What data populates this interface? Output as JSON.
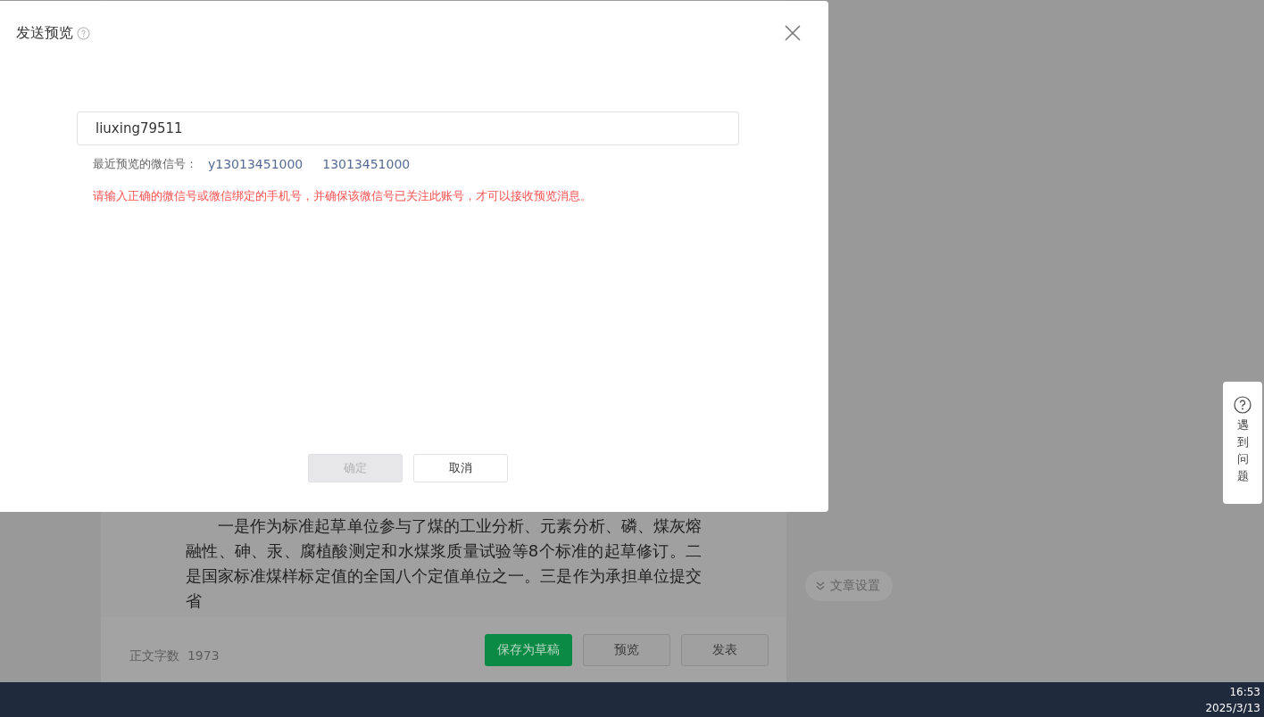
{
  "dialog": {
    "title": "发送预览",
    "input": {
      "value": "liuxing79511"
    },
    "recent_label": "最近预览的微信号：",
    "recent_ids": [
      "y13013451000",
      "13013451000"
    ],
    "error": "请输入正确的微信号或微信绑定的手机号，并确保该微信号已关注此账号，才可以接收预览消息。",
    "buttons": [
      {
        "label": "确定",
        "disabled": true
      },
      {
        "label": "取消",
        "disabled": false
      }
    ]
  },
  "article": {
    "paragraph": "一是作为标准起草单位参与了煤的工业分析、元素分析、磷、煤灰熔融性、砷、汞、腐植酸测定和水煤浆质量试验等8个标准的起草修订。二是国家标准煤样标定值的全国八个定值单位之一。三是作为承担单位提交省"
  },
  "footer": {
    "word_count_label": "正文字数",
    "word_count": "1973",
    "buttons": [
      {
        "label": "保存为草稿",
        "kind": "primary"
      },
      {
        "label": "预览",
        "kind": "default"
      },
      {
        "label": "发表",
        "kind": "default"
      }
    ]
  },
  "article_settings": "文章设置",
  "help_tab": "遇到问题",
  "taskbar": {
    "time": "16:53",
    "date": "2025/3/13"
  }
}
